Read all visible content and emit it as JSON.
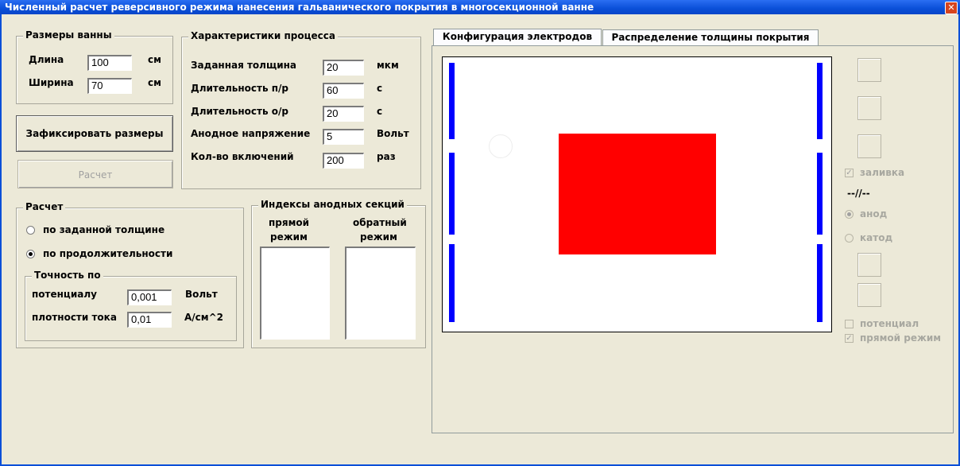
{
  "window": {
    "title": "Численный расчет реверсивного режима нанесения гальванического покрытия в многосекционной ванне",
    "close_glyph": "✕"
  },
  "bath_size": {
    "legend": "Размеры ванны",
    "length_label": "Длина",
    "length_value": "100",
    "length_unit": "см",
    "width_label": "Ширина",
    "width_value": "70",
    "width_unit": "см"
  },
  "process": {
    "legend": "Характеристики процесса",
    "rows": [
      {
        "label": "Заданная толщина",
        "value": "20",
        "unit": "мкм"
      },
      {
        "label": "Длительность п/р",
        "value": "60",
        "unit": "с"
      },
      {
        "label": "Длительность о/р",
        "value": "20",
        "unit": "с"
      },
      {
        "label": "Анодное напряжение",
        "value": "5",
        "unit": "Вольт"
      },
      {
        "label": "Кол-во включений",
        "value": "200",
        "unit": "раз"
      }
    ]
  },
  "buttons": {
    "fix_size": "Зафиксировать размеры",
    "calculate": "Расчет"
  },
  "calc": {
    "legend": "Расчет",
    "option_thickness": "по заданной толщине",
    "option_duration": "по продолжительности",
    "selected": "option_duration"
  },
  "accuracy": {
    "legend": "Точность по",
    "potential_label": "потенциалу",
    "potential_value": "0,001",
    "potential_unit": "Вольт",
    "current_label": "плотности тока",
    "current_value": "0,01",
    "current_unit": "А/см^2"
  },
  "anode_indices": {
    "legend": "Индексы анодных секций",
    "direct_label_1": "прямой",
    "direct_label_2": "режим",
    "reverse_label_1": "обратный",
    "reverse_label_2": "режим"
  },
  "tabs": [
    {
      "label": "Конфигурация электродов",
      "active": true
    },
    {
      "label": "Распределение толщины покрытия",
      "active": false
    }
  ],
  "canvas": {
    "electrode_color": "#0000ff",
    "part_color": "#ff0000",
    "background": "#ffffff"
  },
  "side_panel": {
    "fill_label": "заливка",
    "fill_checked": true,
    "separator": "--//--",
    "anode_label": "анод",
    "cathode_label": "катод",
    "selected": "anode",
    "potential_label": "потенциал",
    "potential_checked": false,
    "direct_mode_label": "прямой режим",
    "direct_mode_checked": true
  }
}
